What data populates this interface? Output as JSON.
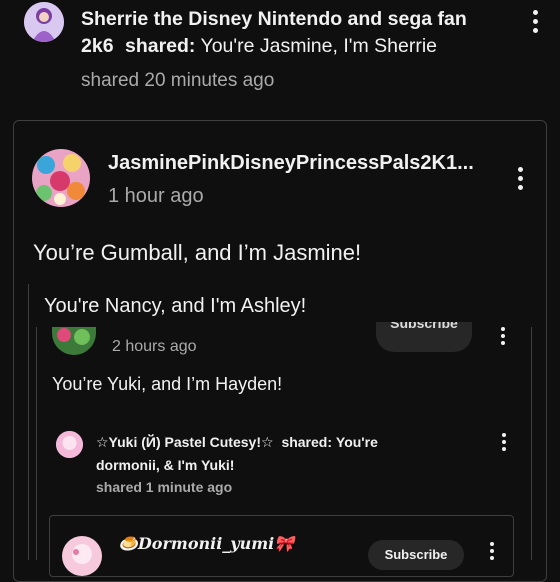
{
  "post": {
    "author": "Sherrie the Disney Nintendo and sega fan 2k6",
    "shared_word": "shared:",
    "title": "You're Jasmine, I'm Sherrie",
    "time": "shared 20 minutes ago",
    "menu_icon": "more-vert-icon"
  },
  "shared_post": {
    "author": "JasminePinkDisneyPrincessPals2K1...",
    "time": "1 hour ago",
    "text": "You’re Gumball, and I’m Jasmine!",
    "menu_icon": "more-vert-icon"
  },
  "screenshot": {
    "caption": "You're Nancy, and I'm Ashley!",
    "time": "2 hours ago",
    "subscribe_label": "Subscribe",
    "text": "You’re Yuki, and I’m Hayden!",
    "nested_share": {
      "author": "☆Yuki (Й) Pastel Cutesy!☆",
      "shared_word": "shared:",
      "title_line1": "You're",
      "title_line2": "dormonii, & I'm Yuki!",
      "time": "shared 1 minute ago"
    },
    "inner_card": {
      "author": "🍮Dormonii_yumi🎀",
      "subscribe_label": "Subscribe"
    }
  },
  "colors": {
    "background": "#0f0f0f",
    "text": "#f1f1f1",
    "muted": "#aaaaaa",
    "border": "#3f3f3f",
    "pill": "#272727"
  }
}
